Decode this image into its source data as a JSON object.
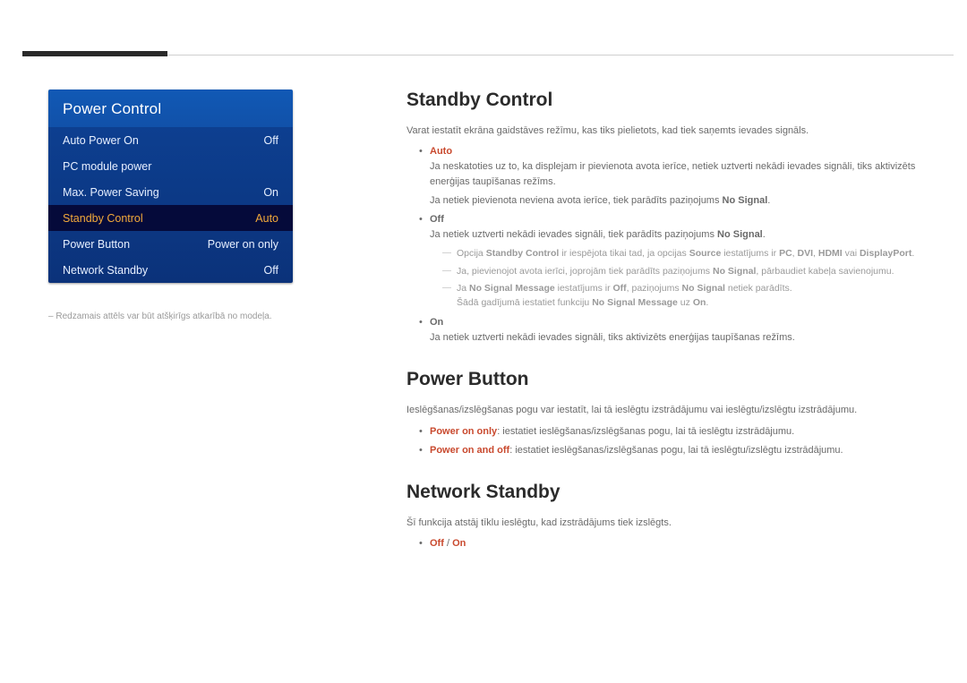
{
  "menu": {
    "title": "Power Control",
    "items": [
      {
        "label": "Auto Power On",
        "value": "Off"
      },
      {
        "label": "PC module power",
        "value": ""
      },
      {
        "label": "Max. Power Saving",
        "value": "On"
      },
      {
        "label": "Standby Control",
        "value": "Auto"
      },
      {
        "label": "Power Button",
        "value": "Power on only"
      },
      {
        "label": "Network Standby",
        "value": "Off"
      }
    ]
  },
  "caption": "Redzamais attēls var būt atšķirīgs atkarībā no modeļa.",
  "sections": {
    "standby": {
      "title": "Standby Control",
      "intro": "Varat iestatīt ekrāna gaidstāves režīmu, kas tiks pielietots, kad tiek saņemts ievades signāls.",
      "labels": {
        "noSignal": "No Signal",
        "standbyControl": "Standby Control",
        "source": "Source",
        "pc": "PC",
        "dvi": "DVI",
        "hdmi": "HDMI",
        "displayPort": "DisplayPort",
        "noSigMsg": "No Signal Message",
        "off": "Off",
        "on": "On"
      },
      "opts": [
        {
          "name": "Auto",
          "p1": "Ja neskatoties uz to, ka displejam ir pievienota avota ierīce, netiek uztverti nekādi ievades signāli, tiks aktivizēts enerģijas taupīšanas režīms.",
          "p2a": "Ja netiek pievienota neviena avota ierīce, tiek parādīts paziņojums ",
          "p2b": "."
        },
        {
          "name": "Off",
          "p1a": "Ja netiek uztverti nekādi ievades signāli, tiek parādīts paziņojums ",
          "p1b": ".",
          "notes": [
            {
              "a": "Opcija ",
              "b": " ir iespējota tikai tad, ja opcijas ",
              "c": " iestatījums ir ",
              "d": " vai "
            },
            {
              "a": "Ja, pievienojot avota ierīci, joprojām tiek parādīts paziņojums ",
              "b": ", pārbaudiet kabeļa savienojumu."
            },
            {
              "a": "Ja ",
              "b": " iestatījums ir ",
              "c": ", paziņojums ",
              "d": " netiek parādīts.",
              "e": "Šādā gadījumā iestatiet funkciju ",
              "f": " uz "
            }
          ]
        },
        {
          "name": "On",
          "p1": "Ja netiek uztverti nekādi ievades signāli, tiks aktivizēts enerģijas taupīšanas režīms."
        }
      ]
    },
    "power": {
      "title": "Power Button",
      "intro": "Ieslēgšanas/izslēgšanas pogu var iestatīt, lai tā ieslēgtu izstrādājumu vai ieslēgtu/izslēgtu izstrādājumu.",
      "opts": [
        {
          "name": "Power on only",
          "text": ": iestatiet ieslēgšanas/izslēgšanas pogu, lai tā ieslēgtu izstrādājumu."
        },
        {
          "name": "Power on and off",
          "text": ": iestatiet ieslēgšanas/izslēgšanas pogu, lai tā ieslēgtu/izslēgtu izstrādājumu."
        }
      ]
    },
    "network": {
      "title": "Network Standby",
      "intro": "Šī funkcija atstāj tīklu ieslēgtu, kad izstrādājums tiek izslēgts.",
      "opts": [
        "Off",
        "On"
      ]
    }
  }
}
